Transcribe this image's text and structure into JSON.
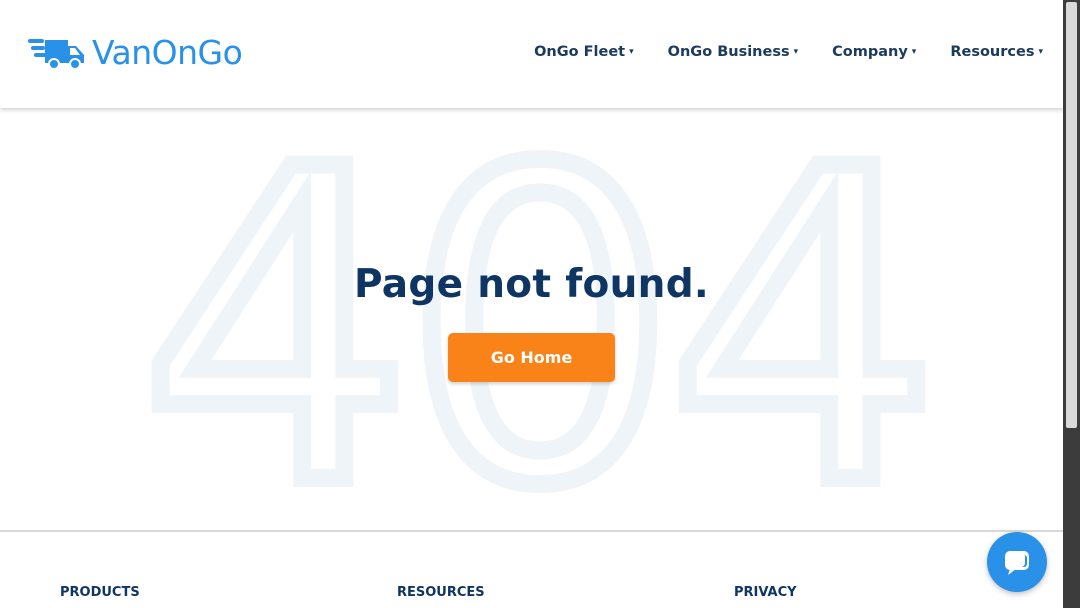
{
  "brand": {
    "name": "VanOnGo",
    "color": "#2a91e9",
    "icon": "delivery-truck-icon"
  },
  "nav": {
    "items": [
      {
        "label": "OnGo Fleet"
      },
      {
        "label": "OnGo Business"
      },
      {
        "label": "Company"
      },
      {
        "label": "Resources"
      }
    ],
    "caret": "▾"
  },
  "main": {
    "background_text": "404",
    "title": "Page not found.",
    "cta_label": "Go Home",
    "cta_color": "#f98219"
  },
  "footer": {
    "columns": [
      {
        "heading": "PRODUCTS"
      },
      {
        "heading": "RESOURCES"
      },
      {
        "heading": "PRIVACY"
      }
    ]
  },
  "chat": {
    "icon": "chat-bubble-icon"
  }
}
